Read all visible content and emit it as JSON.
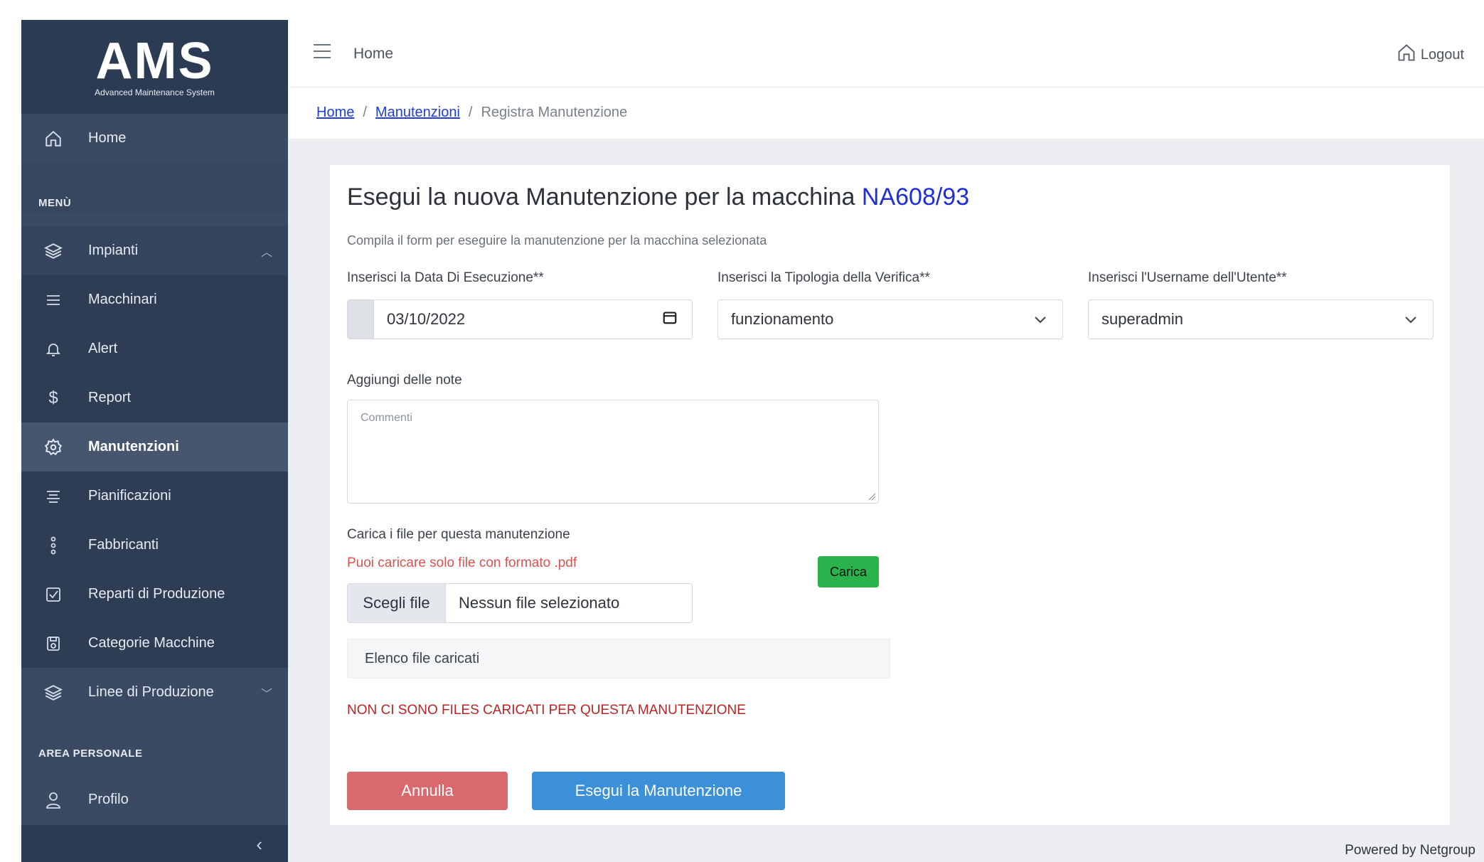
{
  "app": {
    "logo_text": "AMS",
    "logo_subtitle": "Advanced Maintenance System"
  },
  "sidebar": {
    "home_label": "Home",
    "section_menu": "MENÙ",
    "items": [
      {
        "label": "Impianti",
        "icon": "layers-icon",
        "chevron": "up"
      },
      {
        "label": "Macchinari",
        "icon": "list-icon"
      },
      {
        "label": "Alert",
        "icon": "bell-icon"
      },
      {
        "label": "Report",
        "icon": "dollar-icon"
      },
      {
        "label": "Manutenzioni",
        "icon": "gear-icon",
        "active": true
      },
      {
        "label": "Pianificazioni",
        "icon": "align-center-icon"
      },
      {
        "label": "Fabbricanti",
        "icon": "vertical-dots-icon"
      },
      {
        "label": "Reparti di Produzione",
        "icon": "check-square-icon"
      },
      {
        "label": "Categorie Macchine",
        "icon": "save-icon"
      },
      {
        "label": "Linee di Produzione",
        "icon": "layers-icon",
        "chevron": "down"
      }
    ],
    "section_personal": "AREA PERSONALE",
    "profile_label": "Profilo",
    "colors": {
      "bg": "#3a4a63",
      "logo_bg": "#2c3b54",
      "active": "#46566f"
    }
  },
  "topbar": {
    "title": "Home",
    "logout_label": "Logout"
  },
  "breadcrumb": {
    "home": "Home",
    "manutenzioni": "Manutenzioni",
    "separator": "/",
    "current": "Registra Manutenzione"
  },
  "form": {
    "title_prefix": "Esegui la nuova Manutenzione per la macchina",
    "machine_code": "NA608/93",
    "subtitle": "Compila il form per eseguire la manutenzione per la macchina selezionata",
    "date_label": "Inserisci la Data Di Esecuzione**",
    "date_value": "03/10/2022",
    "type_label": "Inserisci la Tipologia della Verifica**",
    "type_value": "funzionamento",
    "user_label": "Inserisci l'Username dell'Utente**",
    "user_value": "superadmin",
    "notes_label": "Aggiungi delle note",
    "notes_placeholder": "Commenti",
    "upload_label": "Carica i file per questa manutenzione",
    "upload_hint": "Puoi caricare solo file con formato .pdf",
    "upload_button": "Carica",
    "file_choose": "Scegli file",
    "file_none": "Nessun file selezionato",
    "list_label": "Elenco file caricati",
    "no_files": "NON CI SONO FILES CARICATI PER QUESTA MANUTENZIONE",
    "cancel_button": "Annulla",
    "submit_button": "Esegui la Manutenzione",
    "colors": {
      "machine": "#1e2fd9",
      "cancel": "#d9696d",
      "submit": "#3c8fd9",
      "upload": "#2bb24c",
      "error": "#b82424"
    }
  },
  "footer": {
    "powered": "Powered by Netgroup"
  }
}
